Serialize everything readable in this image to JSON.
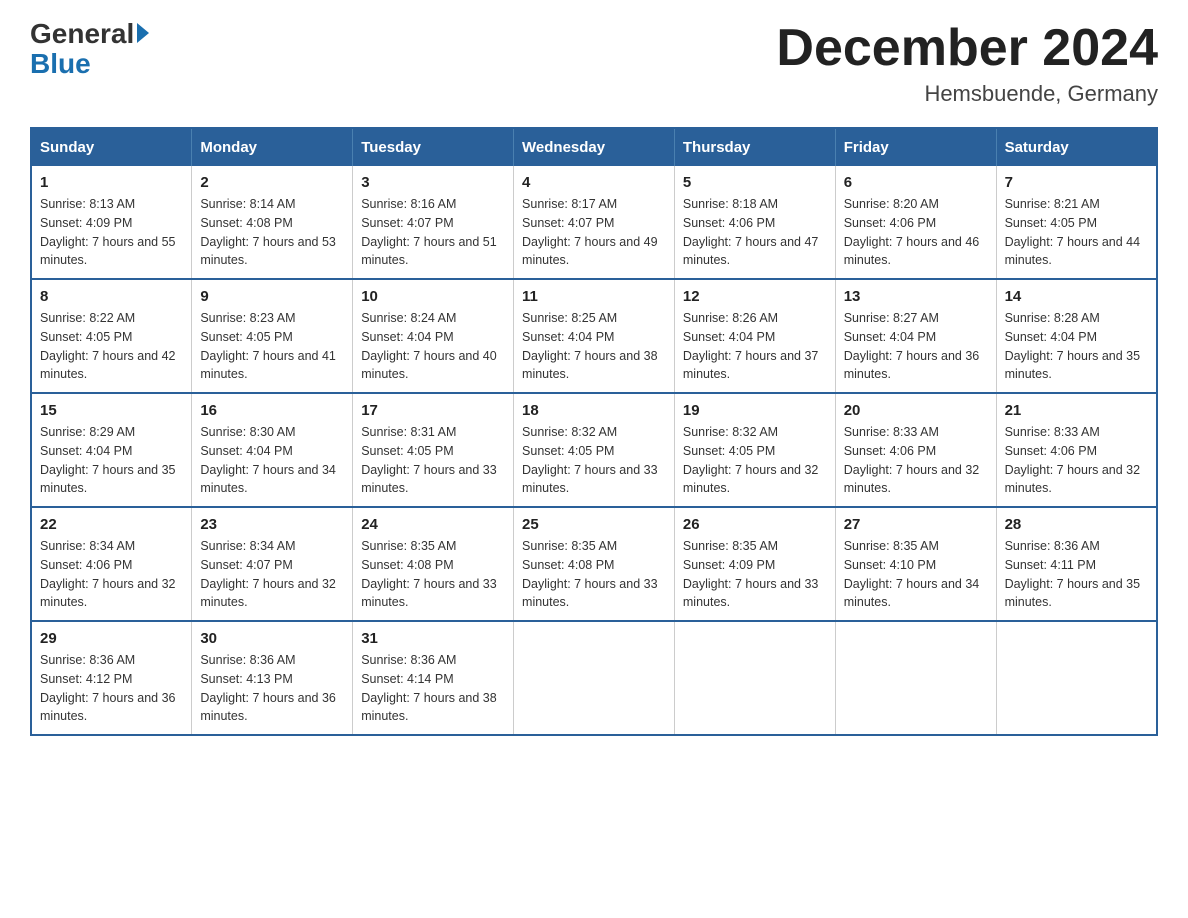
{
  "header": {
    "logo_general": "General",
    "logo_blue": "Blue",
    "title": "December 2024",
    "subtitle": "Hemsbuende, Germany"
  },
  "weekdays": [
    "Sunday",
    "Monday",
    "Tuesday",
    "Wednesday",
    "Thursday",
    "Friday",
    "Saturday"
  ],
  "weeks": [
    [
      {
        "day": "1",
        "sunrise": "8:13 AM",
        "sunset": "4:09 PM",
        "daylight": "7 hours and 55 minutes."
      },
      {
        "day": "2",
        "sunrise": "8:14 AM",
        "sunset": "4:08 PM",
        "daylight": "7 hours and 53 minutes."
      },
      {
        "day": "3",
        "sunrise": "8:16 AM",
        "sunset": "4:07 PM",
        "daylight": "7 hours and 51 minutes."
      },
      {
        "day": "4",
        "sunrise": "8:17 AM",
        "sunset": "4:07 PM",
        "daylight": "7 hours and 49 minutes."
      },
      {
        "day": "5",
        "sunrise": "8:18 AM",
        "sunset": "4:06 PM",
        "daylight": "7 hours and 47 minutes."
      },
      {
        "day": "6",
        "sunrise": "8:20 AM",
        "sunset": "4:06 PM",
        "daylight": "7 hours and 46 minutes."
      },
      {
        "day": "7",
        "sunrise": "8:21 AM",
        "sunset": "4:05 PM",
        "daylight": "7 hours and 44 minutes."
      }
    ],
    [
      {
        "day": "8",
        "sunrise": "8:22 AM",
        "sunset": "4:05 PM",
        "daylight": "7 hours and 42 minutes."
      },
      {
        "day": "9",
        "sunrise": "8:23 AM",
        "sunset": "4:05 PM",
        "daylight": "7 hours and 41 minutes."
      },
      {
        "day": "10",
        "sunrise": "8:24 AM",
        "sunset": "4:04 PM",
        "daylight": "7 hours and 40 minutes."
      },
      {
        "day": "11",
        "sunrise": "8:25 AM",
        "sunset": "4:04 PM",
        "daylight": "7 hours and 38 minutes."
      },
      {
        "day": "12",
        "sunrise": "8:26 AM",
        "sunset": "4:04 PM",
        "daylight": "7 hours and 37 minutes."
      },
      {
        "day": "13",
        "sunrise": "8:27 AM",
        "sunset": "4:04 PM",
        "daylight": "7 hours and 36 minutes."
      },
      {
        "day": "14",
        "sunrise": "8:28 AM",
        "sunset": "4:04 PM",
        "daylight": "7 hours and 35 minutes."
      }
    ],
    [
      {
        "day": "15",
        "sunrise": "8:29 AM",
        "sunset": "4:04 PM",
        "daylight": "7 hours and 35 minutes."
      },
      {
        "day": "16",
        "sunrise": "8:30 AM",
        "sunset": "4:04 PM",
        "daylight": "7 hours and 34 minutes."
      },
      {
        "day": "17",
        "sunrise": "8:31 AM",
        "sunset": "4:05 PM",
        "daylight": "7 hours and 33 minutes."
      },
      {
        "day": "18",
        "sunrise": "8:32 AM",
        "sunset": "4:05 PM",
        "daylight": "7 hours and 33 minutes."
      },
      {
        "day": "19",
        "sunrise": "8:32 AM",
        "sunset": "4:05 PM",
        "daylight": "7 hours and 32 minutes."
      },
      {
        "day": "20",
        "sunrise": "8:33 AM",
        "sunset": "4:06 PM",
        "daylight": "7 hours and 32 minutes."
      },
      {
        "day": "21",
        "sunrise": "8:33 AM",
        "sunset": "4:06 PM",
        "daylight": "7 hours and 32 minutes."
      }
    ],
    [
      {
        "day": "22",
        "sunrise": "8:34 AM",
        "sunset": "4:06 PM",
        "daylight": "7 hours and 32 minutes."
      },
      {
        "day": "23",
        "sunrise": "8:34 AM",
        "sunset": "4:07 PM",
        "daylight": "7 hours and 32 minutes."
      },
      {
        "day": "24",
        "sunrise": "8:35 AM",
        "sunset": "4:08 PM",
        "daylight": "7 hours and 33 minutes."
      },
      {
        "day": "25",
        "sunrise": "8:35 AM",
        "sunset": "4:08 PM",
        "daylight": "7 hours and 33 minutes."
      },
      {
        "day": "26",
        "sunrise": "8:35 AM",
        "sunset": "4:09 PM",
        "daylight": "7 hours and 33 minutes."
      },
      {
        "day": "27",
        "sunrise": "8:35 AM",
        "sunset": "4:10 PM",
        "daylight": "7 hours and 34 minutes."
      },
      {
        "day": "28",
        "sunrise": "8:36 AM",
        "sunset": "4:11 PM",
        "daylight": "7 hours and 35 minutes."
      }
    ],
    [
      {
        "day": "29",
        "sunrise": "8:36 AM",
        "sunset": "4:12 PM",
        "daylight": "7 hours and 36 minutes."
      },
      {
        "day": "30",
        "sunrise": "8:36 AM",
        "sunset": "4:13 PM",
        "daylight": "7 hours and 36 minutes."
      },
      {
        "day": "31",
        "sunrise": "8:36 AM",
        "sunset": "4:14 PM",
        "daylight": "7 hours and 38 minutes."
      },
      null,
      null,
      null,
      null
    ]
  ]
}
